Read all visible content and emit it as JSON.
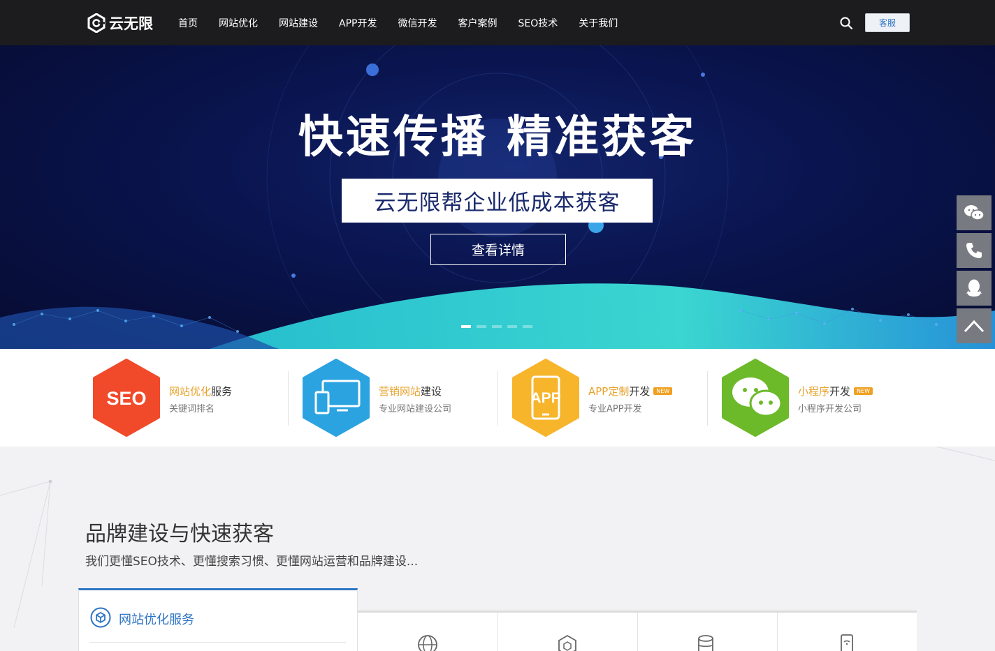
{
  "header": {
    "logo_text": "云无限",
    "nav": [
      "首页",
      "网站优化",
      "网站建设",
      "APP开发",
      "微信开发",
      "客户案例",
      "SEO技术",
      "关于我们"
    ],
    "search_icon": "search-icon",
    "kefu_label": "客服"
  },
  "hero": {
    "title": "快速传播 精准获客",
    "subtitle": "云无限帮企业低成本获客",
    "button_label": "查看详情",
    "slide_count": 5,
    "active_slide": 1
  },
  "float_bar": {
    "icons": [
      "wechat-icon",
      "phone-icon",
      "qq-icon",
      "back-to-top-icon"
    ]
  },
  "services": [
    {
      "hex_text": "SEO",
      "hex_color": "#f04a2a",
      "title_hl": "网站优化",
      "title_rest": "服务",
      "new": false,
      "desc": "关键词排名",
      "icon": "seo-icon"
    },
    {
      "hex_text": "",
      "hex_color": "#2ba3e0",
      "title_hl": "营销网站",
      "title_rest": "建设",
      "new": false,
      "desc": "专业网站建设公司",
      "icon": "devices-icon"
    },
    {
      "hex_text": "APP",
      "hex_color": "#f7b52c",
      "title_hl": "APP定制",
      "title_rest": "开发",
      "new": true,
      "new_label": "NEW",
      "desc": "专业APP开发",
      "icon": "app-icon"
    },
    {
      "hex_text": "",
      "hex_color": "#6cb92a",
      "title_hl": "小程序",
      "title_rest": "开发",
      "new": true,
      "new_label": "NEW",
      "desc": "小程序开发公司",
      "icon": "wechat-icon"
    }
  ],
  "brand": {
    "title": "品牌建设与快速获客",
    "subtitle": "我们更懂SEO技术、更懂搜索习惯、更懂网站运营和品牌建设...",
    "card_title": "网站优化服务",
    "tiles": [
      "globe-icon",
      "cube-icon",
      "database-icon",
      "mobile-icon"
    ]
  },
  "colors": {
    "header_bg": "#1c1c1e",
    "accent": "#2e74c4",
    "highlight": "#e8a22a"
  }
}
